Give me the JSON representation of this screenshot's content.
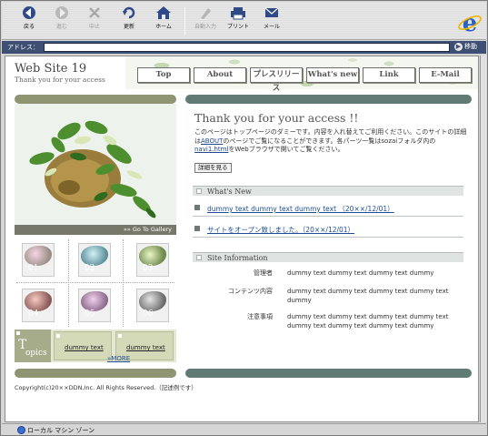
{
  "browser": {
    "toolbar": [
      {
        "label": "戻る",
        "icon": "back-arrow-icon",
        "enabled": true
      },
      {
        "label": "進む",
        "icon": "forward-arrow-icon",
        "enabled": false
      },
      {
        "label": "中止",
        "icon": "stop-x-icon",
        "enabled": false
      },
      {
        "label": "更新",
        "icon": "refresh-icon",
        "enabled": true
      },
      {
        "label": "ホーム",
        "icon": "home-icon",
        "enabled": true
      },
      {
        "label": "自動入力",
        "icon": "autofill-icon",
        "enabled": false
      },
      {
        "label": "プリント",
        "icon": "print-icon",
        "enabled": true
      },
      {
        "label": "メール",
        "icon": "mail-icon",
        "enabled": true
      }
    ],
    "address_label": "アドレス：",
    "address_value": "",
    "go_label": "移動",
    "status_text": "ローカル マシン ゾーン"
  },
  "site": {
    "title": "Web Site 19",
    "subtitle": "Thank you for your access"
  },
  "nav": [
    "Top",
    "About",
    "プレスリリース",
    "What's new",
    "Link",
    "E-Mail"
  ],
  "hero": {
    "caption": "»» Go To Gallery"
  },
  "thumbs": [
    "01",
    "02",
    "03",
    "04",
    "05",
    "06"
  ],
  "topics": {
    "label_first": "T",
    "label_rest": "opics",
    "items": [
      "dummy text",
      "dummy text"
    ]
  },
  "main": {
    "title": "Thank you for your access !!",
    "intro_1": "このページはトップページのダミーです。内容を入れ替えてご利用ください。このサイトの詳細は",
    "intro_link1": "ABOUT",
    "intro_2": "のページでご覧になることができます。各パーツ一覧はsozaiフォルダ内の",
    "intro_link2": "navi1.html",
    "intro_3": "をWebブラウザで開いてご覧ください。",
    "detail_button": "詳細を見る"
  },
  "whats_new": {
    "heading": "What's New",
    "items": [
      "dummy text dummy text dummy text （20××/12/01）",
      "サイトをオープン致しました。（20××/12/01）"
    ]
  },
  "site_info": {
    "heading": "Site Information",
    "rows": [
      {
        "key": "管理者",
        "value": "dummy text dummy text dummy text dummy"
      },
      {
        "key": "コンテンツ内容",
        "value": "dummy text dummy text dummy text dummy text dummy"
      },
      {
        "key": "注意事項",
        "value": "dummy text dummy text dummy text dummy text dummy text dummy text dummy text dummy"
      }
    ],
    "more": "»MORE"
  },
  "footer": {
    "copyright": "Copyright(c)20××DDN,Inc. All Rights Reserved.（記述例です）"
  },
  "colors": {
    "olive": "#8f9473",
    "teal": "#5f7b73",
    "link": "#1e4d95",
    "chrome_dark": "#3d4f72"
  }
}
